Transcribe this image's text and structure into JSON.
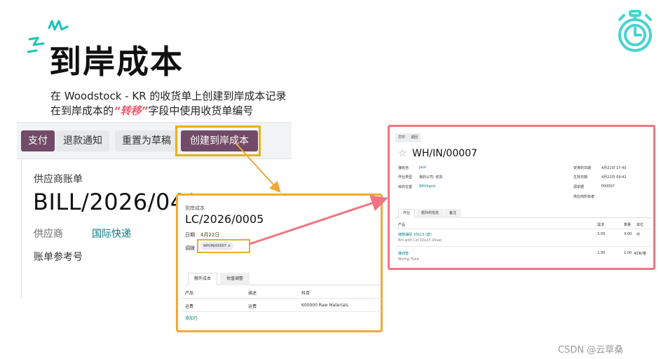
{
  "slide": {
    "title": "到岸成本",
    "subtitle_line1": "在 Woodstock - KR 的收货单上创建到岸成本记录",
    "subtitle_line2_pre": "在到岸成本的",
    "subtitle_line2_hl": "“转移”",
    "subtitle_line2_post": "字段中使用收货单编号",
    "watermark": "CSDN @云草桑"
  },
  "bill": {
    "toolbar": {
      "pay": "支付",
      "refund_notice": "退款通知",
      "reset_draft": "重置为草稿",
      "create_landed_cost": "创建到岸成本"
    },
    "doc_label": "供应商账单",
    "number": "BILL/2026/04/",
    "vendor_label": "供应商",
    "vendor_value": "国际快递",
    "bill_ref_label": "账单参考号"
  },
  "landed_cost": {
    "kind_label": "到岸成本",
    "name": "LC/2026/0005",
    "date_label": "日期",
    "date_value": "4月22日",
    "transfers_label": "调拨",
    "transfer_tag": "WH/IN/00007",
    "tabs": [
      "额外成本",
      "估值调整"
    ],
    "columns": [
      "产品",
      "描述",
      "科目"
    ],
    "rows": [
      {
        "product": "运费",
        "description": "运费",
        "account": "600000 Raw Materials"
      }
    ],
    "add_line": "添加行"
  },
  "receipt": {
    "buttons": [
      "打印",
      "退回"
    ],
    "name": "WH/IN/00007",
    "fields_left": [
      {
        "label": "接收自",
        "value": "Jack"
      },
      {
        "label": "作业类型",
        "value": "我的公司: 收货"
      },
      {
        "label": "目的位置",
        "value": "WH/Input"
      }
    ],
    "fields_right": [
      {
        "label": "安排的日期",
        "value": "4月21日 17:40"
      },
      {
        "label": "生效日期",
        "value": "4月22日 09:42"
      },
      {
        "label": "源单据",
        "value": "P00007"
      },
      {
        "label": "供应商所有者",
        "value": ""
      }
    ],
    "tabs": [
      "作业",
      "额外的信息",
      "备注"
    ],
    "columns": [
      "产品",
      "需求",
      "数量",
      "单位"
    ],
    "rows": [
      {
        "product": "储物抽屉 10x13 (蓝)",
        "description": "Bin with Lid 10x13 (blue)",
        "demand": "3.00",
        "quantity": "3.00",
        "unit": "件"
      },
      {
        "product": "接线管",
        "description": "Wiring Tube",
        "demand": "1.00",
        "quantity": "1.00",
        "unit": "40米/卷"
      }
    ]
  },
  "colors": {
    "primary": "#714b67",
    "link": "#017e84",
    "highlight_yellow": "#e3b21c",
    "highlight_orange": "#f0a838",
    "highlight_pink": "#f17581",
    "accent_pink": "#ef5a70",
    "timer_teal": "#4ad3d0",
    "burst_teal": "#19c4b8"
  },
  "icons": {
    "burst": "burst-decoration-icon",
    "timer": "stopwatch-icon",
    "favorite": "star-icon"
  }
}
